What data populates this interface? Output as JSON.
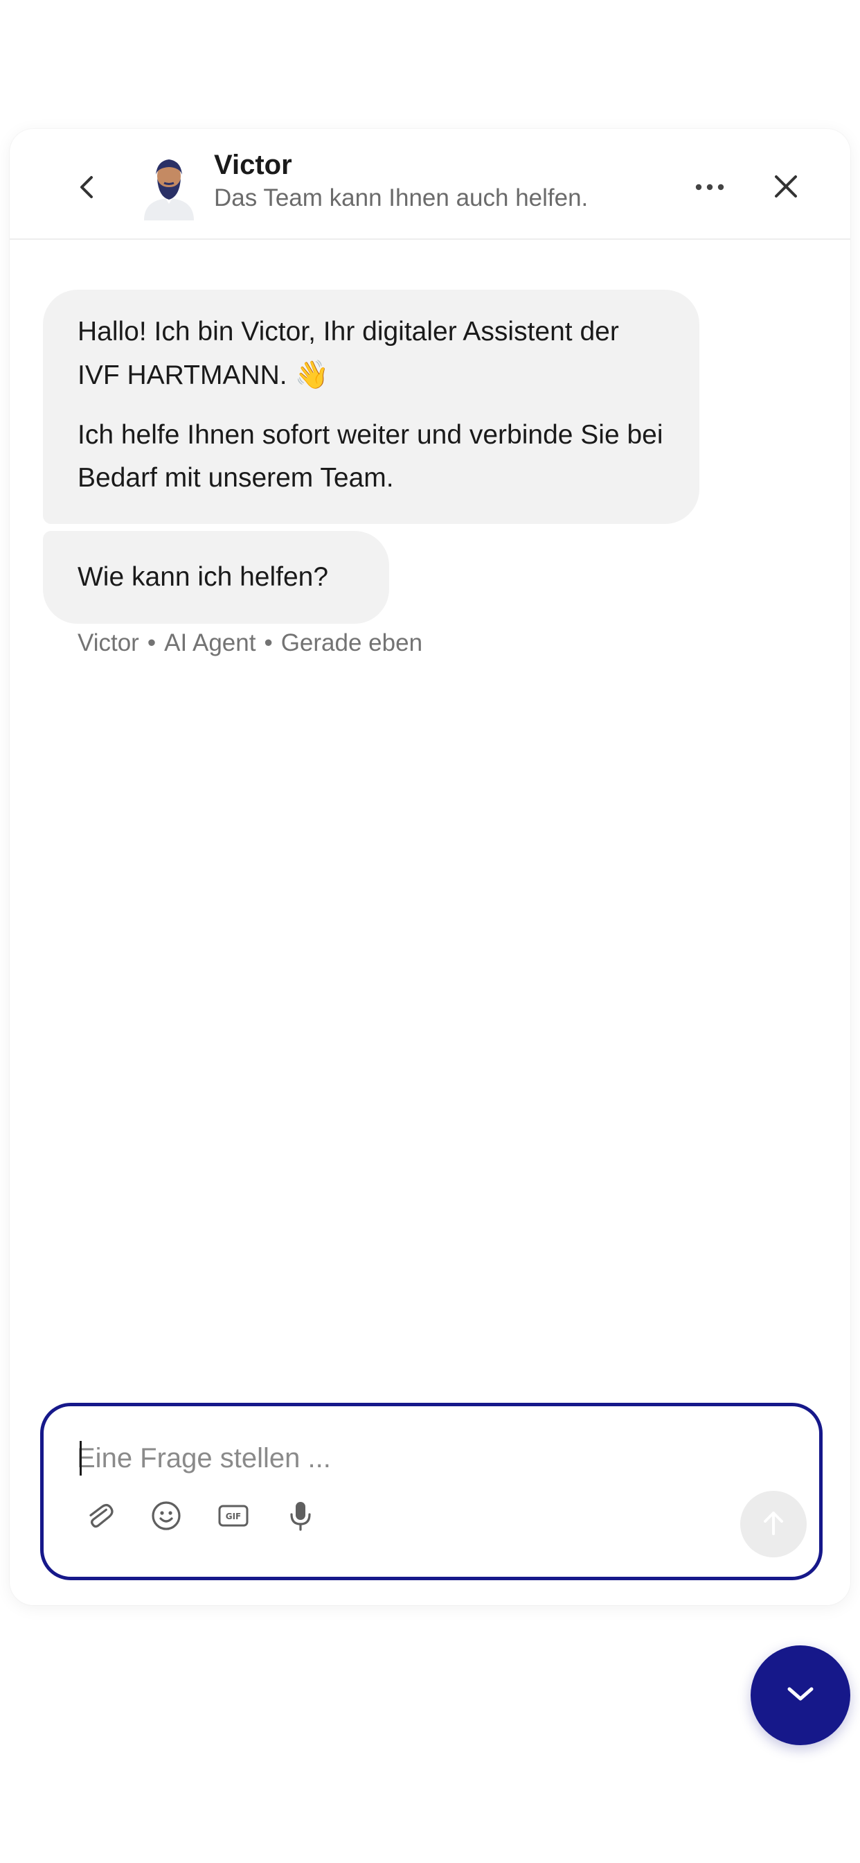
{
  "header": {
    "agent_name": "Victor",
    "subtitle": "Das Team kann Ihnen auch helfen.",
    "back_icon": "chevron-left-icon",
    "more_icon": "more-horizontal-icon",
    "close_icon": "close-icon"
  },
  "messages": [
    {
      "paragraphs": [
        "Hallo! Ich bin Victor, Ihr digitaler Assistent der IVF HARTMANN.",
        "Ich helfe Ihnen sofort weiter und verbinde Sie bei Bedarf mit unserem Team."
      ],
      "emoji": "👋"
    },
    {
      "paragraphs": [
        "Wie kann ich helfen?"
      ]
    }
  ],
  "meta": {
    "sender": "Victor",
    "role": "AI Agent",
    "time": "Gerade eben",
    "separator": "•"
  },
  "composer": {
    "placeholder": "Eine Frage stellen ...",
    "tools": [
      "paperclip-icon",
      "emoji-icon",
      "gif-icon",
      "microphone-icon"
    ],
    "gif_label": "GIF",
    "send_icon": "arrow-up-icon"
  },
  "fab": {
    "icon": "chevron-down-icon"
  },
  "colors": {
    "accent": "#16188a",
    "bubble": "#f2f2f2",
    "muted_text": "#737373",
    "send_disabled": "#ececec"
  }
}
